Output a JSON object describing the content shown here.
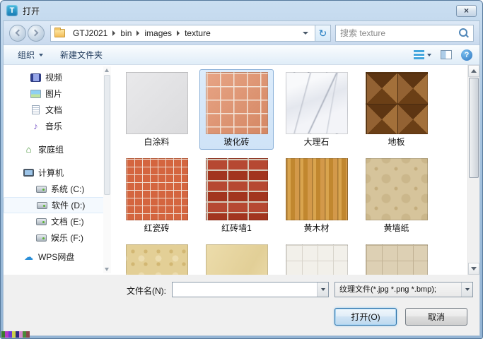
{
  "window": {
    "title": "打开"
  },
  "icons": {
    "app_glyph": "T",
    "close_glyph": "×",
    "refresh_glyph": "↻",
    "help_glyph": "?",
    "music_glyph": "♪",
    "homegroup_glyph": "⌂",
    "cloud_glyph": "☁"
  },
  "address_bar": {
    "breadcrumb": [
      {
        "label": "GTJ2021"
      },
      {
        "label": "bin"
      },
      {
        "label": "images"
      },
      {
        "label": "texture"
      }
    ],
    "search_placeholder": "搜索 texture"
  },
  "toolbar": {
    "organize_label": "组织",
    "new_folder_label": "新建文件夹"
  },
  "sidebar": {
    "items": [
      {
        "label": "视频",
        "icon": "video-icon"
      },
      {
        "label": "图片",
        "icon": "picture-icon"
      },
      {
        "label": "文档",
        "icon": "document-icon"
      },
      {
        "label": "音乐",
        "icon": "music-icon"
      },
      {
        "label": "家庭组",
        "icon": "homegroup-icon"
      },
      {
        "label": "计算机",
        "icon": "computer-icon"
      },
      {
        "label": "系统 (C:)",
        "icon": "drive-icon"
      },
      {
        "label": "软件 (D:)",
        "icon": "drive-icon"
      },
      {
        "label": "文档 (E:)",
        "icon": "drive-icon"
      },
      {
        "label": "娱乐 (F:)",
        "icon": "drive-icon"
      },
      {
        "label": "WPS网盘",
        "icon": "cloud-icon"
      }
    ]
  },
  "files": [
    {
      "name": "白涂料",
      "selected": false
    },
    {
      "name": "玻化砖",
      "selected": true
    },
    {
      "name": "大理石",
      "selected": false
    },
    {
      "name": "地板",
      "selected": false
    },
    {
      "name": "红瓷砖",
      "selected": false
    },
    {
      "name": "红砖墙1",
      "selected": false
    },
    {
      "name": "黄木材",
      "selected": false
    },
    {
      "name": "黄墙纸",
      "selected": false
    }
  ],
  "footer": {
    "filename_label": "文件名(N):",
    "filename_value": "",
    "filetype_value": "纹理文件(*.jpg *.png *.bmp);",
    "open_label": "打开(O)",
    "cancel_label": "取消"
  },
  "colors": {
    "selection_bg": "#d6e7f8",
    "selection_border": "#8ab0d8",
    "titlebar": "#a9c6e1"
  }
}
